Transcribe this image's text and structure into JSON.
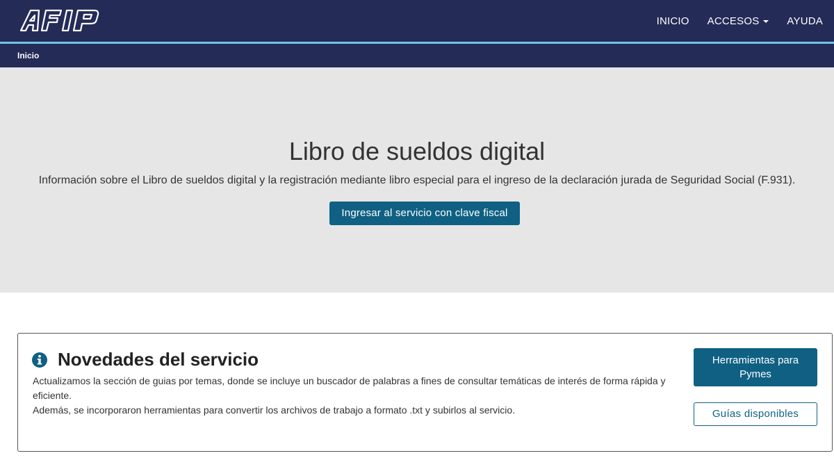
{
  "header": {
    "logo_alt": "AFIP",
    "nav": [
      {
        "label": "INICIO"
      },
      {
        "label": "ACCESOS"
      },
      {
        "label": "AYUDA"
      }
    ]
  },
  "breadcrumb": {
    "items": [
      "Inicio"
    ]
  },
  "hero": {
    "title": "Libro de sueldos digital",
    "description": "Información sobre el Libro de sueldos digital y la registración mediante libro especial para el ingreso de la declaración jurada de Seguridad Social (F.931).",
    "button_label": "Ingresar al servicio con clave fiscal"
  },
  "news": {
    "icon": "info-icon",
    "title": "Novedades del servicio",
    "paragraph1": "Actualizamos la sección de guias por temas, donde se incluye un buscador de palabras a fines de consultar temáticas de interés de forma rápida y eficiente.",
    "paragraph2": "Además, se incorporaron herramientas para convertir los archivos de trabajo a formato .txt y subirlos al servicio.",
    "primary_button": "Herramientas para Pymes",
    "secondary_button": "Guías disponibles"
  },
  "colors": {
    "header_bg": "#242b57",
    "accent_line": "#6ec6e8",
    "hero_bg": "#e6e6e6",
    "button_primary": "#0f6083"
  }
}
